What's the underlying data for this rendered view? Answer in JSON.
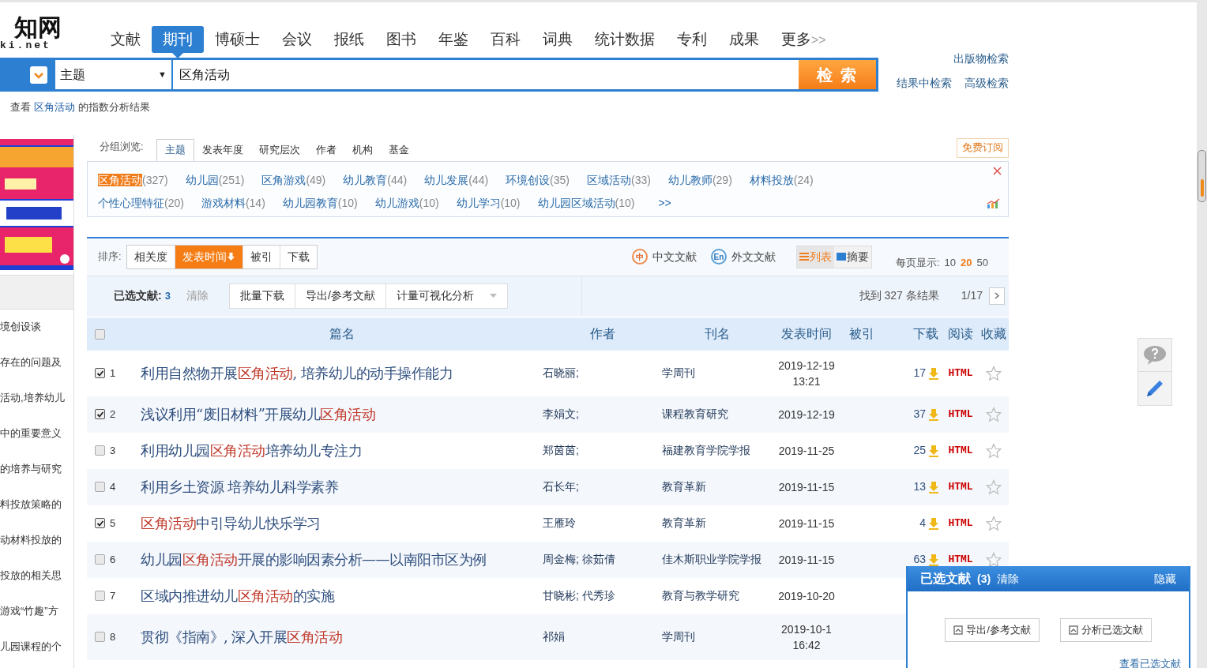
{
  "logo": {
    "mark": "知网",
    "domain": "ki.net"
  },
  "nav_tabs": [
    {
      "label": "文献",
      "selected": false
    },
    {
      "label": "期刊",
      "selected": true
    },
    {
      "label": "博硕士",
      "selected": false
    },
    {
      "label": "会议",
      "selected": false
    },
    {
      "label": "报纸",
      "selected": false
    },
    {
      "label": "图书",
      "selected": false
    },
    {
      "label": "年鉴",
      "selected": false
    },
    {
      "label": "百科",
      "selected": false
    },
    {
      "label": "词典",
      "selected": false
    },
    {
      "label": "统计数据",
      "selected": false
    },
    {
      "label": "专利",
      "selected": false
    },
    {
      "label": "成果",
      "selected": false
    },
    {
      "label": "更多",
      "suffix": ">>",
      "selected": false
    }
  ],
  "search": {
    "field_type": "主题",
    "caret": "▼",
    "value": "区角活动",
    "button": "检 索"
  },
  "search_links": [
    "出版物检索",
    "结果中检索",
    "高级检索"
  ],
  "index_hint": {
    "prefix": "查看",
    "keyword": "区角活动",
    "suffix": "的指数分析结果"
  },
  "sidebar": {
    "items": [
      "境创设谈",
      "存在的问题及",
      "活动,培养幼儿",
      "中的重要意义",
      "的培养与研究",
      "料投放策略的",
      "动材料投放的",
      "投放的相关思",
      "游戏“竹趣”方",
      "儿园课程的个"
    ]
  },
  "group_browse": {
    "label": "分组浏览:",
    "subscribe": "免费订阅",
    "more": ">>",
    "tabs": [
      {
        "label": "主题",
        "selected": true
      },
      {
        "label": "发表年度",
        "selected": false
      },
      {
        "label": "研究层次",
        "selected": false
      },
      {
        "label": "作者",
        "selected": false
      },
      {
        "label": "机构",
        "selected": false
      },
      {
        "label": "基金",
        "selected": false
      }
    ],
    "tag_rows": [
      [
        {
          "label": "区角活动",
          "count": "(327)",
          "selected": true
        },
        {
          "label": "幼儿园",
          "count": "(251)",
          "selected": false
        },
        {
          "label": "区角游戏",
          "count": "(49)",
          "selected": false
        },
        {
          "label": "幼儿教育",
          "count": "(44)",
          "selected": false
        },
        {
          "label": "幼儿发展",
          "count": "(44)",
          "selected": false
        },
        {
          "label": "环境创设",
          "count": "(35)",
          "selected": false
        },
        {
          "label": "区域活动",
          "count": "(33)",
          "selected": false
        },
        {
          "label": "幼儿教师",
          "count": "(29)",
          "selected": false
        },
        {
          "label": "材料投放",
          "count": "(24)",
          "selected": false
        }
      ],
      [
        {
          "label": "个性心理特征",
          "count": "(20)",
          "selected": false
        },
        {
          "label": "游戏材料",
          "count": "(14)",
          "selected": false
        },
        {
          "label": "幼儿园教育",
          "count": "(10)",
          "selected": false
        },
        {
          "label": "幼儿游戏",
          "count": "(10)",
          "selected": false
        },
        {
          "label": "幼儿学习",
          "count": "(10)",
          "selected": false
        },
        {
          "label": "幼儿园区域活动",
          "count": "(10)",
          "selected": false
        }
      ]
    ]
  },
  "sort": {
    "label": "排序:",
    "options": [
      {
        "label": "相关度",
        "selected": false
      },
      {
        "label": "发表时间",
        "selected": true
      },
      {
        "label": "被引",
        "selected": false
      },
      {
        "label": "下载",
        "selected": false
      }
    ]
  },
  "language_filters": [
    {
      "badge": "中",
      "label": "中文文献"
    },
    {
      "badge": "En",
      "label": "外文文献"
    }
  ],
  "view_modes": [
    {
      "label": "列表",
      "selected": true
    },
    {
      "label": "摘要",
      "selected": false
    }
  ],
  "page_size": {
    "label": "每页显示:",
    "options": [
      {
        "label": "10",
        "selected": false
      },
      {
        "label": "20",
        "selected": true
      },
      {
        "label": "50",
        "selected": false
      }
    ]
  },
  "selection": {
    "label": "已选文献:",
    "count": "3",
    "clear": "清除",
    "actions": [
      "批量下载",
      "导出/参考文献",
      "计量可视化分析"
    ],
    "found": "找到 327 条结果",
    "page": "1/17"
  },
  "table": {
    "select_all": false,
    "columns": [
      "篇名",
      "作者",
      "刊名",
      "发表时间",
      "被引",
      "下载",
      "阅读",
      "收藏"
    ],
    "rows": [
      {
        "checked": true,
        "number": "1",
        "title": "利用自然物开展**区角活动**, 培养幼儿的动手操作能力",
        "author": "石晓丽;",
        "journal": "学周刊",
        "date": "2019-12-19",
        "time": "13:21",
        "downloads": "17",
        "read": "HTML"
      },
      {
        "checked": true,
        "number": "2",
        "title": "浅议利用“废旧材料”开展幼儿**区角活动**",
        "author": "李娟文;",
        "journal": "课程教育研究",
        "date": "2019-12-19",
        "downloads": "37",
        "read": "HTML"
      },
      {
        "checked": false,
        "number": "3",
        "title": "利用幼儿园**区角活动**培养幼儿专注力",
        "author": "郑茵茵;",
        "journal": "福建教育学院学报",
        "date": "2019-11-25",
        "downloads": "25",
        "read": "HTML"
      },
      {
        "checked": false,
        "number": "4",
        "title": "利用乡土资源  培养幼儿科学素养",
        "author": "石长年;",
        "journal": "教育革新",
        "date": "2019-11-15",
        "downloads": "13",
        "read": "HTML"
      },
      {
        "checked": true,
        "number": "5",
        "title": "**区角活动**中引导幼儿快乐学习",
        "author": "王雁玲",
        "journal": "教育革新",
        "date": "2019-11-15",
        "downloads": "4",
        "read": "HTML"
      },
      {
        "checked": false,
        "number": "6",
        "title": "幼儿园**区角活动**开展的影响因素分析——以南阳市区为例",
        "author": "周金梅; 徐茹倩",
        "journal": "佳木斯职业学院学报",
        "date": "2019-11-15",
        "downloads": "63",
        "read": "HTML"
      },
      {
        "checked": false,
        "number": "7",
        "title": "区域内推进幼儿**区角活动**的实施",
        "author": "甘晓彬; 代秀珍",
        "journal": "教育与教学研究",
        "date": "2019-10-20"
      },
      {
        "checked": false,
        "number": "8",
        "title": "贯彻《指南》, 深入开展**区角活动**",
        "author": "祁娟",
        "journal": "学周刊",
        "date": "2019-10-1",
        "time": "16:42"
      }
    ]
  },
  "selected_panel": {
    "title": "已选文献",
    "count": "(3)",
    "clear": "清除",
    "hide": "隐藏",
    "buttons": [
      "导出/参考文献",
      "分析已选文献"
    ],
    "link": "查看已选文献"
  }
}
